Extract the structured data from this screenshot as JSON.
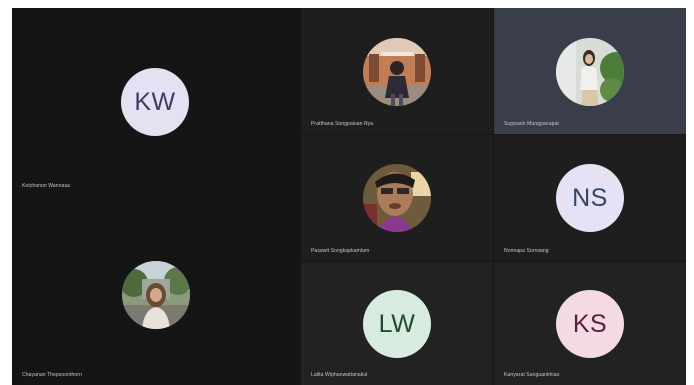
{
  "meeting": {
    "participants": [
      {
        "initials": "KW",
        "name": "Kotchanon Wannasa",
        "avatar_bg": "#e4e2f2",
        "initials_color": "#3d3d68",
        "photo": false
      },
      {
        "initials": "",
        "name": "Pratthana Songpaisan Rya",
        "photo": true,
        "photo_style": "outdoor-building"
      },
      {
        "initials": "",
        "name": "Suppasin Mungpanapat",
        "photo": true,
        "photo_style": "outdoor-greenery"
      },
      {
        "initials": "",
        "name": "Pasawit Songkapkamlam",
        "photo": true,
        "photo_style": "selfie-glasses"
      },
      {
        "initials": "NS",
        "name": "Nonnapa Sornsang",
        "avatar_bg": "#e5e2f6",
        "initials_color": "#33456a",
        "photo": false
      },
      {
        "initials": "",
        "name": "Chayanan Thepsoonthorn",
        "photo": true,
        "photo_style": "trees"
      },
      {
        "initials": "LW",
        "name": "Lalita Wiphanwattanakul",
        "avatar_bg": "#d7ecdf",
        "initials_color": "#1e4d30",
        "photo": false
      },
      {
        "initials": "KS",
        "name": "Kanyarat Sanguankhiao",
        "avatar_bg": "#f4dae5",
        "initials_color": "#5a2038",
        "photo": false
      }
    ]
  },
  "colors": {
    "stage_bg": "#151515",
    "tile_bg": "#1c1c1c",
    "tile_bg_alt": "#222222",
    "tile_active_bg": "#3a3d4a"
  }
}
